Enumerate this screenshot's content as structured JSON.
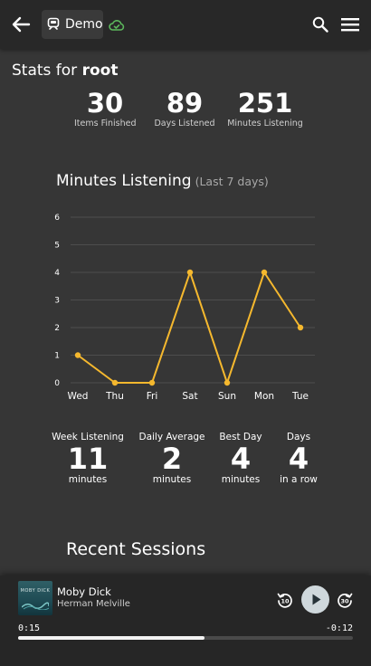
{
  "appbar": {
    "library_name": "Demo",
    "icons": [
      "arrow-left-icon",
      "library-icon",
      "cloud-check-icon",
      "search-icon",
      "menu-icon"
    ]
  },
  "stats": {
    "title_prefix": "Stats for",
    "username": "root",
    "items_finished": {
      "value": "30",
      "label": "Items Finished"
    },
    "days_listened": {
      "value": "89",
      "label": "Days Listened"
    },
    "minutes_listening": {
      "value": "251",
      "label": "Minutes Listening"
    }
  },
  "chart_title": {
    "main": "Minutes Listening",
    "sub": "(Last 7 days)"
  },
  "chart_data": {
    "type": "line",
    "title": "Minutes Listening",
    "subtitle": "(Last 7 days)",
    "categories": [
      "Wed",
      "Thu",
      "Fri",
      "Sat",
      "Sun",
      "Mon",
      "Tue"
    ],
    "values": [
      1,
      0,
      0,
      4,
      0,
      4,
      2
    ],
    "ylim": [
      0,
      6
    ],
    "yticks": [
      0,
      1,
      2,
      3,
      4,
      5,
      6
    ],
    "grid": true,
    "line_color": "#f5b82e",
    "grid_color": "#4d4d4d"
  },
  "week_summary": {
    "week_listening": {
      "label": "Week Listening",
      "value": "11",
      "unit": "minutes"
    },
    "daily_average": {
      "label": "Daily Average",
      "value": "2",
      "unit": "minutes"
    },
    "best_day": {
      "label": "Best Day",
      "value": "4",
      "unit": "minutes"
    },
    "days_in_row": {
      "label": "Days",
      "value": "4",
      "unit": "in a row"
    }
  },
  "recent_sessions": {
    "title": "Recent Sessions"
  },
  "player": {
    "book_title": "Moby Dick",
    "author": "Herman Melville",
    "cover_text": "MOBY DICK",
    "time_current": "0:15",
    "time_remaining": "-0:12",
    "progress": 0.556,
    "rewind_seconds": "10",
    "forward_seconds": "30"
  },
  "colors": {
    "background": "#363636",
    "appbar": "#282828",
    "accent_line": "#f5b82e",
    "cloud_ok": "#5cb85c",
    "play_button": "#cfd8dc"
  }
}
